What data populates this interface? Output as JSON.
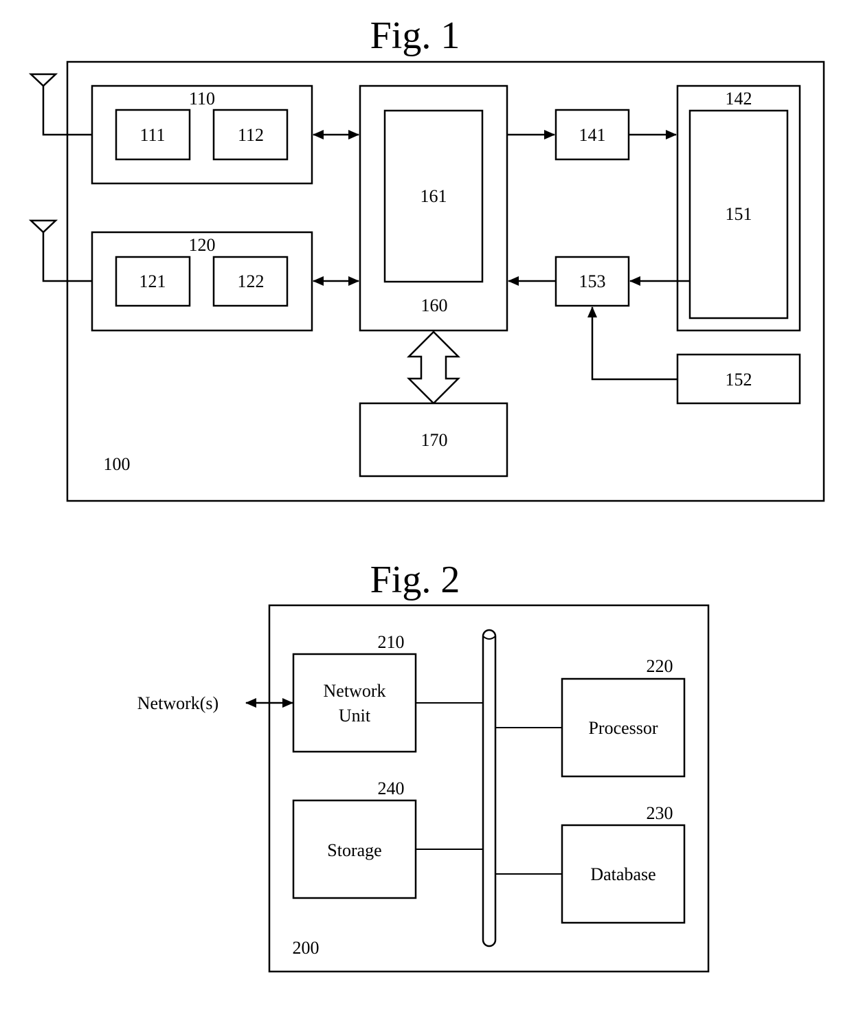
{
  "fig1": {
    "title": "Fig. 1",
    "device_label": "100",
    "blocks": {
      "b110": "110",
      "b111": "111",
      "b112": "112",
      "b120": "120",
      "b121": "121",
      "b122": "122",
      "b160": "160",
      "b161": "161",
      "b141": "141",
      "b142": "142",
      "b151": "151",
      "b153": "153",
      "b152": "152",
      "b170": "170"
    }
  },
  "fig2": {
    "title": "Fig. 2",
    "system_label": "200",
    "network_label": "Network(s)",
    "units": {
      "network_unit": {
        "ref": "210",
        "line1": "Network",
        "line2": "Unit"
      },
      "processor": {
        "ref": "220",
        "label": "Processor"
      },
      "database": {
        "ref": "230",
        "label": "Database"
      },
      "storage": {
        "ref": "240",
        "label": "Storage"
      }
    }
  }
}
